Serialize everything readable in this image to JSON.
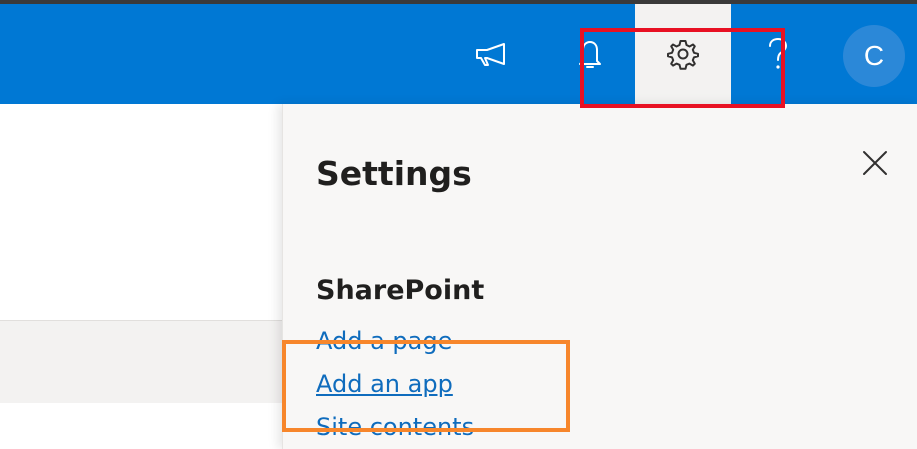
{
  "suite_bar": {
    "background_color": "#0078d4",
    "icons": {
      "megaphone": "megaphone-icon",
      "bell": "bell-icon",
      "settings": "gear-icon",
      "help": "question-icon"
    },
    "avatar": {
      "initial": "C",
      "color": "#2b88d8"
    }
  },
  "settings_panel": {
    "title": "Settings",
    "close_icon": "close-icon",
    "section_heading": "SharePoint",
    "links": [
      {
        "label": "Add a page"
      },
      {
        "label": "Add an app"
      },
      {
        "label": "Site contents"
      }
    ],
    "link_color": "#0f6cbd"
  },
  "annotations": {
    "settings_highlight_color": "#e81123",
    "link_highlight_color": "#f7862b"
  }
}
